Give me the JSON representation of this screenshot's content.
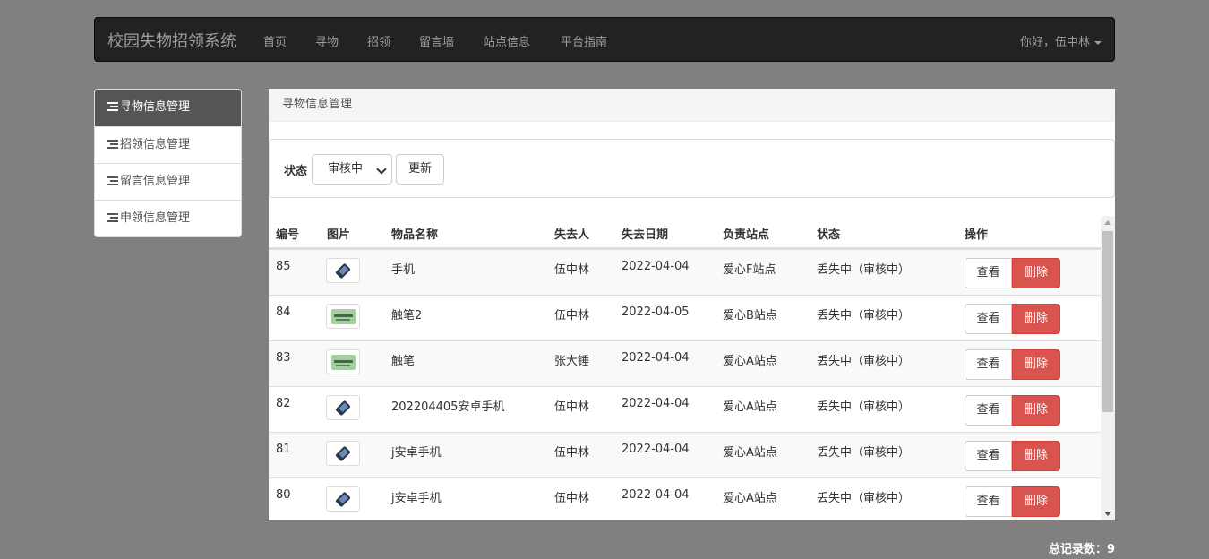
{
  "navbar": {
    "brand": "校园失物招领系统",
    "items": [
      "首页",
      "寻物",
      "招领",
      "留言墙",
      "站点信息",
      "平台指南"
    ],
    "user_greeting": "你好，伍中林"
  },
  "sidebar": {
    "items": [
      {
        "label": "寻物信息管理",
        "active": true
      },
      {
        "label": "招领信息管理",
        "active": false
      },
      {
        "label": "留言信息管理",
        "active": false
      },
      {
        "label": "申领信息管理",
        "active": false
      }
    ]
  },
  "panel": {
    "heading": "寻物信息管理",
    "filter": {
      "label": "状态",
      "selected": "审核中",
      "update_button": "更新"
    }
  },
  "table": {
    "headers": [
      "编号",
      "图片",
      "物品名称",
      "失去人",
      "失去日期",
      "负责站点",
      "状态",
      "操作"
    ],
    "view_label": "查看",
    "delete_label": "删除",
    "rows": [
      {
        "id": "85",
        "image_icon": "phone-icon",
        "name": "手机",
        "owner": "伍中林",
        "date": "2022-04-04",
        "site": "爱心F站点",
        "status": "丢失中（审核中）"
      },
      {
        "id": "84",
        "image_icon": "stylus-icon",
        "name": "触笔2",
        "owner": "伍中林",
        "date": "2022-04-05",
        "site": "爱心B站点",
        "status": "丢失中（审核中）"
      },
      {
        "id": "83",
        "image_icon": "stylus-icon",
        "name": "触笔",
        "owner": "张大锤",
        "date": "2022-04-04",
        "site": "爱心A站点",
        "status": "丢失中（审核中）"
      },
      {
        "id": "82",
        "image_icon": "phone-icon",
        "name": "202204405安卓手机",
        "owner": "伍中林",
        "date": "2022-04-04",
        "site": "爱心A站点",
        "status": "丢失中（审核中）"
      },
      {
        "id": "81",
        "image_icon": "phone-icon",
        "name": "j安卓手机",
        "owner": "伍中林",
        "date": "2022-04-04",
        "site": "爱心A站点",
        "status": "丢失中（审核中）"
      },
      {
        "id": "80",
        "image_icon": "phone-icon",
        "name": "j安卓手机",
        "owner": "伍中林",
        "date": "2022-04-04",
        "site": "爱心A站点",
        "status": "丢失中（审核中）"
      }
    ]
  },
  "footer": {
    "total_records": "总记录数：9"
  },
  "colors": {
    "background": "#808080",
    "navbar": "#222222",
    "sidebar_active": "#555555",
    "delete_button": "#d9534f"
  }
}
